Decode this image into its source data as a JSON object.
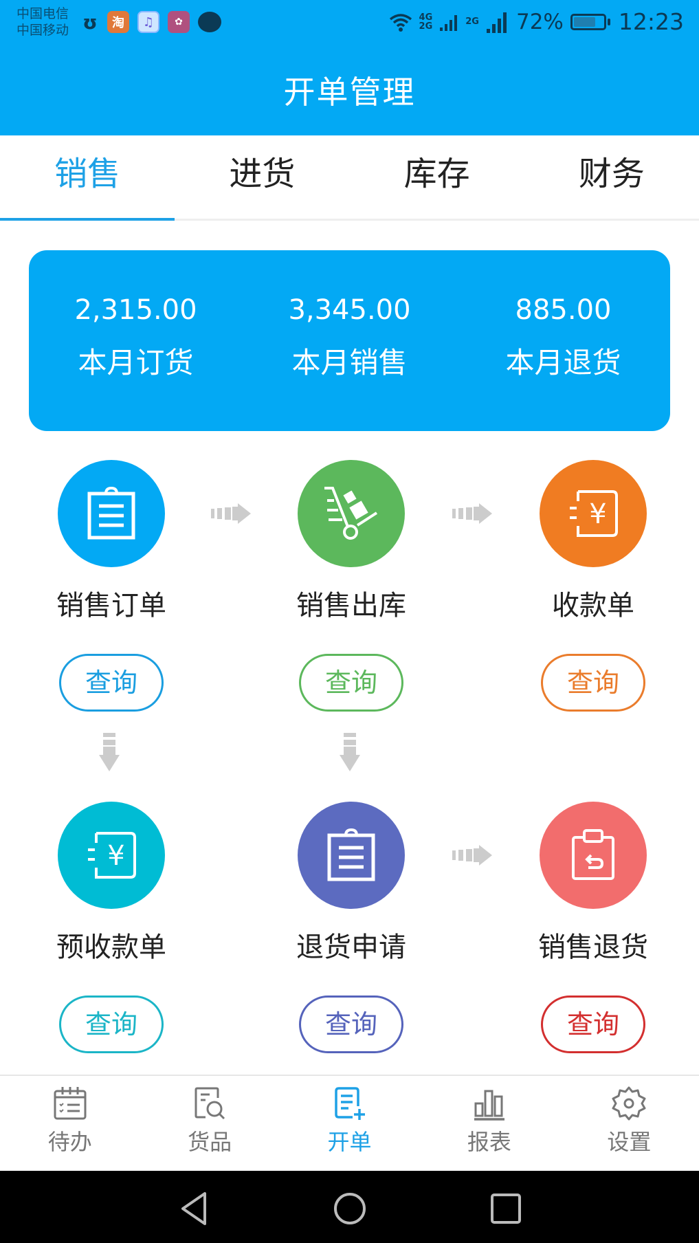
{
  "status_bar": {
    "carrier_1": "中国电信",
    "carrier_2": "中国移动",
    "notification_icons": [
      "cow-app-icon",
      "taobao-icon",
      "music-icon",
      "huawei-icon",
      "chat-icon"
    ],
    "taobao_glyph": "淘",
    "network_1": "4G",
    "network_2": "2G",
    "network_3": "2G",
    "battery_percent": "72%",
    "battery_level": 0.72,
    "time": "12:23"
  },
  "header": {
    "title": "开单管理"
  },
  "tabs": [
    {
      "label": "销售",
      "active": true
    },
    {
      "label": "进货",
      "active": false
    },
    {
      "label": "库存",
      "active": false
    },
    {
      "label": "财务",
      "active": false
    }
  ],
  "summary": {
    "color": "#03a9f4",
    "stats": [
      {
        "value": "2,315.00",
        "label": "本月订货"
      },
      {
        "value": "3,345.00",
        "label": "本月销售"
      },
      {
        "value": "885.00",
        "label": "本月退货"
      }
    ]
  },
  "flow": {
    "query_label": "查询",
    "items": [
      {
        "label": "销售订单",
        "icon": "clipboard-icon",
        "color": "#03a9f4",
        "button_color": "#1a9ee0"
      },
      {
        "label": "销售出库",
        "icon": "hand-truck-icon",
        "color": "#5cb85c",
        "button_color": "#5cb85c"
      },
      {
        "label": "收款单",
        "icon": "yuan-receipt-icon",
        "color": "#f07c22",
        "button_color": "#ea7c2c"
      },
      {
        "label": "预收款单",
        "icon": "yuan-receipt-icon",
        "color": "#00bcd4",
        "button_color": "#1bb5c7"
      },
      {
        "label": "退货申请",
        "icon": "clipboard-icon",
        "color": "#5c6bc0",
        "button_color": "#5563bb"
      },
      {
        "label": "销售退货",
        "icon": "return-clipboard-icon",
        "color": "#f26d6d",
        "button_color": "#d32f2f"
      }
    ]
  },
  "bottom_nav": [
    {
      "label": "待办",
      "icon": "calendar-checklist-icon",
      "active": false
    },
    {
      "label": "货品",
      "icon": "document-search-icon",
      "active": false
    },
    {
      "label": "开单",
      "icon": "document-add-icon",
      "active": true
    },
    {
      "label": "报表",
      "icon": "bar-chart-icon",
      "active": false
    },
    {
      "label": "设置",
      "icon": "gear-icon",
      "active": false
    }
  ],
  "colors": {
    "primary": "#03a9f4",
    "tab_active": "#1ea1e6",
    "text_dark": "#222222",
    "nav_inactive": "#777777",
    "arrow_gray": "#cccccc"
  }
}
